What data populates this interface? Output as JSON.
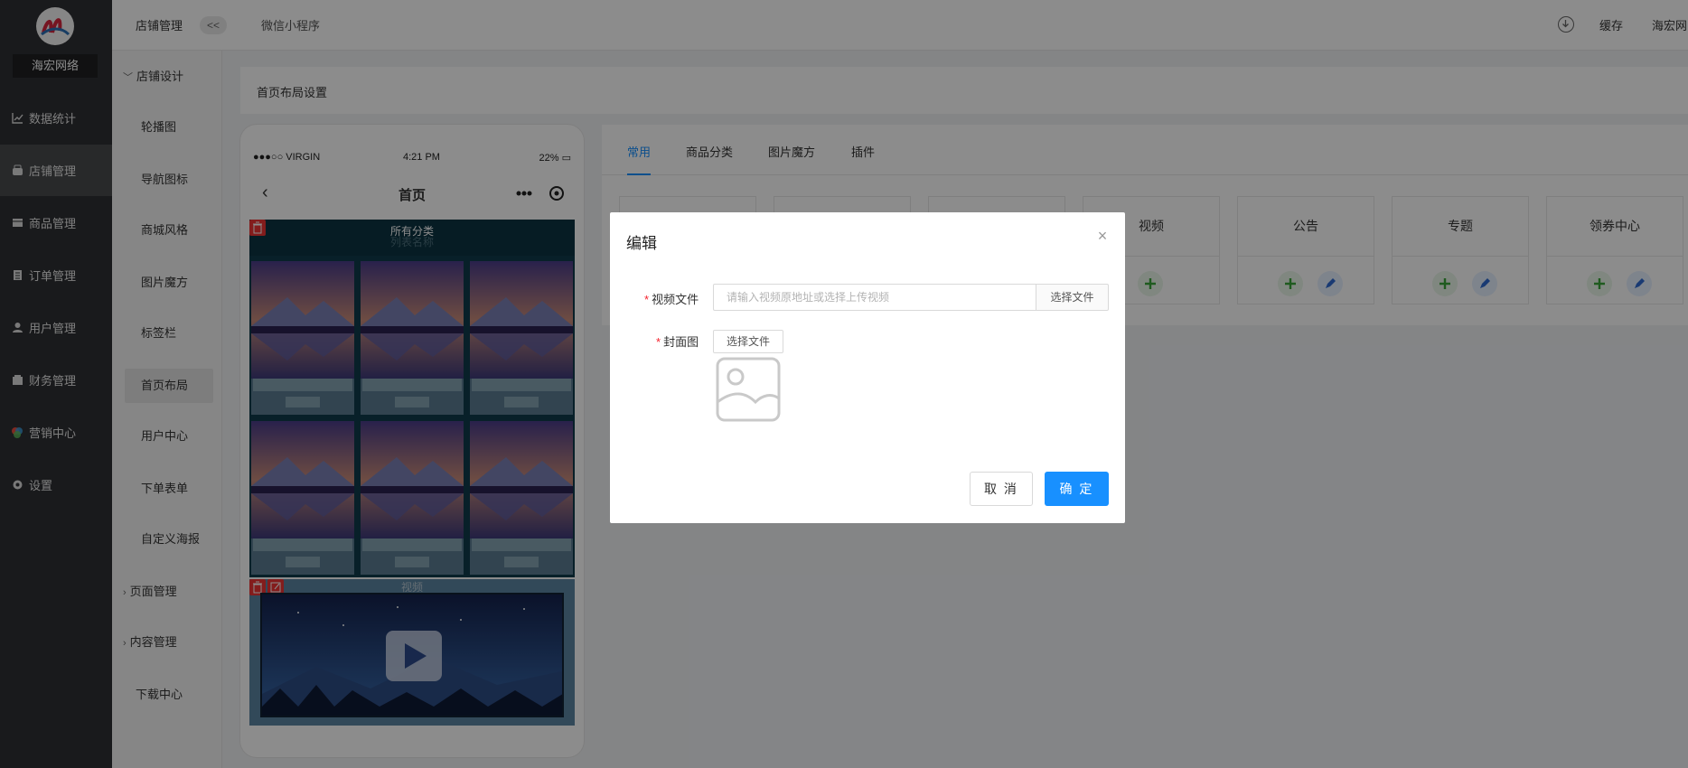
{
  "sidebar": {
    "brand": "海宏网络",
    "items": [
      {
        "label": "数据统计",
        "icon": "chart-line-icon"
      },
      {
        "label": "店铺管理",
        "icon": "store-icon"
      },
      {
        "label": "商品管理",
        "icon": "box-icon"
      },
      {
        "label": "订单管理",
        "icon": "order-list-icon"
      },
      {
        "label": "用户管理",
        "icon": "user-icon"
      },
      {
        "label": "财务管理",
        "icon": "wallet-icon"
      },
      {
        "label": "营销中心",
        "icon": "palette-icon"
      },
      {
        "label": "设置",
        "icon": "gear-icon"
      }
    ],
    "active_index": 1
  },
  "subnav": {
    "group_open": "店铺设计",
    "children": [
      "轮播图",
      "导航图标",
      "商城风格",
      "图片魔方",
      "标签栏",
      "首页布局",
      "用户中心",
      "下单表单",
      "自定义海报"
    ],
    "active_child": "首页布局",
    "groups_closed": [
      "页面管理",
      "内容管理"
    ],
    "download": "下载中心"
  },
  "topbar": {
    "title": "店铺管理",
    "collapse": "<<",
    "app": "微信小程序",
    "cache": "缓存",
    "user": "海宏网"
  },
  "breadcrumb": "首页布局设置",
  "phone": {
    "carrier": "●●●○○ VIRGIN",
    "time": "4:21 PM",
    "battery": "22%",
    "page_title": "首页",
    "grid_title": "所有分类",
    "grid_subtitle": "列表名称",
    "video_title": "视频"
  },
  "tabs": [
    "常用",
    "商品分类",
    "图片魔方",
    "插件"
  ],
  "widgets": [
    "视频",
    "公告",
    "专题",
    "领券中心"
  ],
  "modal": {
    "title": "编辑",
    "video_label": "视频文件",
    "video_placeholder": "请输入视频原地址或选择上传视频",
    "select_file": "选择文件",
    "cover_label": "封面图",
    "cancel": "取 消",
    "ok": "确 定"
  },
  "colors": {
    "primary": "#1890ff",
    "sidebar_bg": "#2f3033",
    "required": "#f5222d"
  }
}
